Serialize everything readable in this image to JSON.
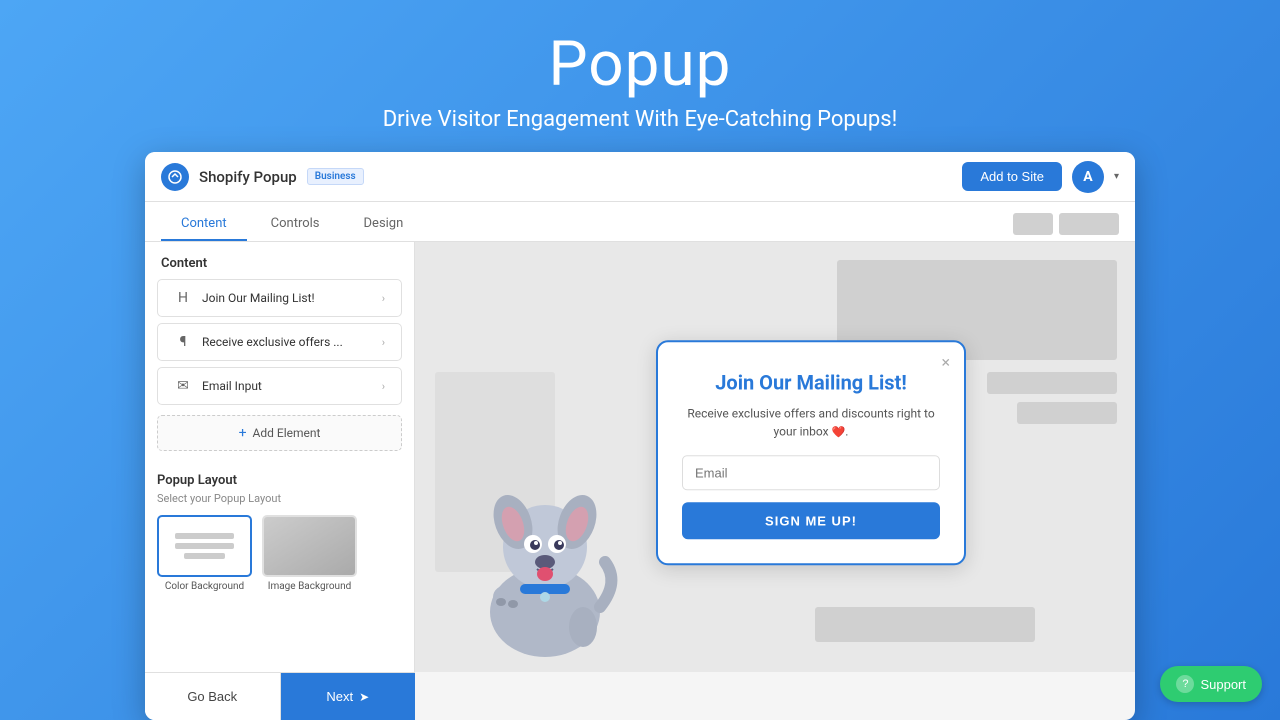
{
  "header": {
    "title": "Popup",
    "subtitle": "Drive Visitor Engagement With Eye-Catching Popups!"
  },
  "topbar": {
    "logo_letter": "♦",
    "app_name": "Shopify Popup",
    "badge": "Business",
    "add_to_site": "Add to Site",
    "avatar_letter": "A"
  },
  "tabs": [
    {
      "label": "Content",
      "active": true
    },
    {
      "label": "Controls",
      "active": false
    },
    {
      "label": "Design",
      "active": false
    }
  ],
  "left_panel": {
    "section_title": "Content",
    "items": [
      {
        "icon": "H",
        "label": "Join Our Mailing List!"
      },
      {
        "icon": "¶",
        "label": "Receive exclusive offers ..."
      },
      {
        "icon": "✉",
        "label": "Email Input"
      }
    ],
    "add_element": "+ Add Element",
    "popup_layout": {
      "title": "Popup Layout",
      "subtitle": "Select your Popup Layout",
      "options": [
        {
          "label": "Color Background",
          "selected": true
        },
        {
          "label": "Image Background",
          "selected": false
        }
      ]
    }
  },
  "bottom_buttons": {
    "go_back": "Go Back",
    "next": "Next"
  },
  "popup": {
    "title": "Join Our Mailing List!",
    "subtitle": "Receive exclusive offers and discounts right to your inbox",
    "heart": "❤️",
    "email_placeholder": "Email",
    "sign_btn": "SIGN ME UP!"
  },
  "support": {
    "label": "Support"
  }
}
